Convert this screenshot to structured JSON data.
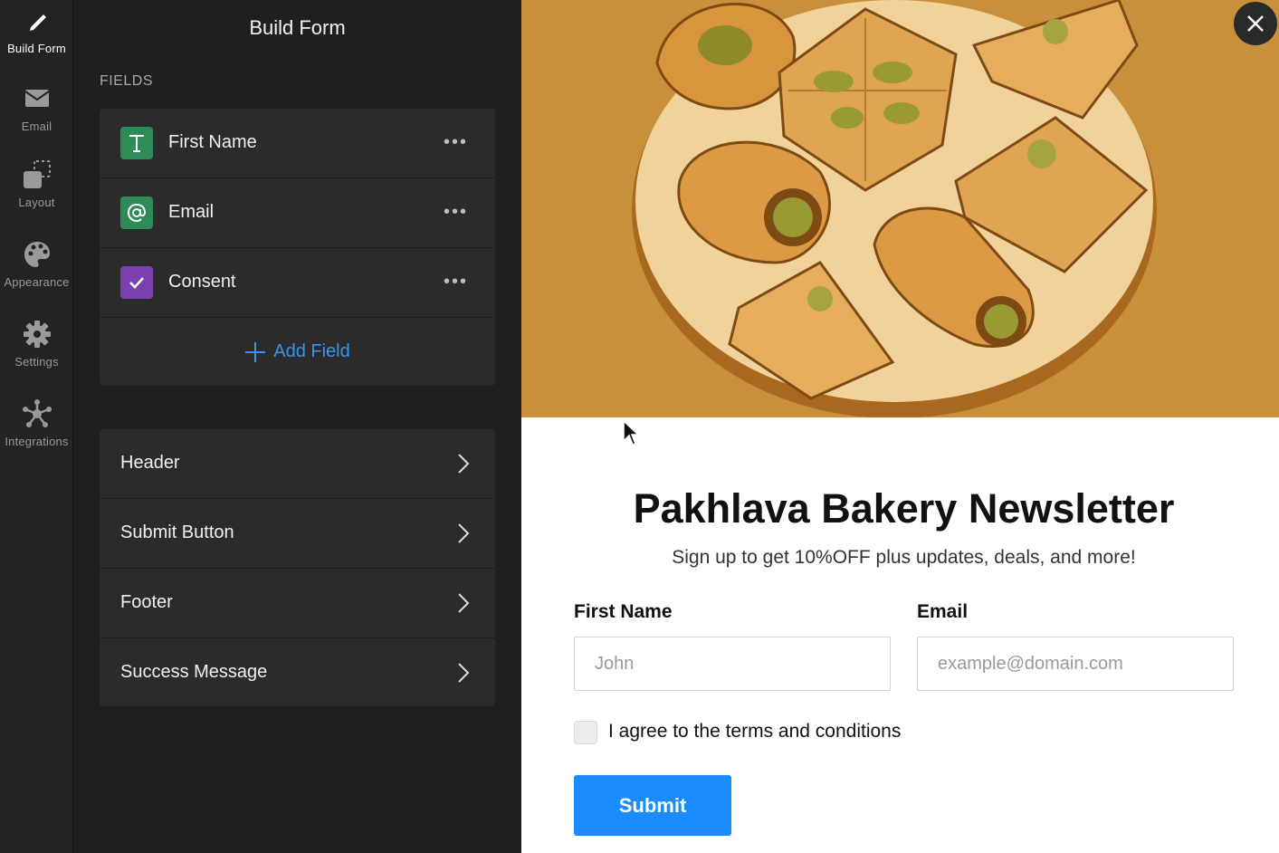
{
  "rail": {
    "items": [
      {
        "label": "Build Form",
        "icon": "pencil-icon",
        "active": true
      },
      {
        "label": "Email",
        "icon": "envelope-icon"
      },
      {
        "label": "Layout",
        "icon": "layout-icon"
      },
      {
        "label": "Appearance",
        "icon": "palette-icon"
      },
      {
        "label": "Settings",
        "icon": "gear-icon"
      },
      {
        "label": "Integrations",
        "icon": "integrations-icon"
      }
    ]
  },
  "panel": {
    "title": "Build Form",
    "fields_label": "FIELDS",
    "fields": [
      {
        "label": "First Name",
        "icon": "text-icon",
        "color": "#2e8b57",
        "more": "•••"
      },
      {
        "label": "Email",
        "icon": "at-icon",
        "color": "#2e8b57",
        "more": "•••"
      },
      {
        "label": "Consent",
        "icon": "checkbox-icon",
        "color": "#7b3fb0",
        "more": "•••"
      }
    ],
    "add_field_label": "Add Field",
    "sections": [
      {
        "label": "Header"
      },
      {
        "label": "Submit Button"
      },
      {
        "label": "Footer"
      },
      {
        "label": "Success Message"
      }
    ]
  },
  "preview": {
    "hero_image": "baklava-plate-illustration",
    "title": "Pakhlava Bakery Newsletter",
    "subtitle": "Sign up to get 10%OFF plus updates, deals, and more!",
    "first_name_label": "First Name",
    "first_name_placeholder": "John",
    "email_label": "Email",
    "email_placeholder": "example@domain.com",
    "consent_text": "I agree to the terms and conditions",
    "submit_label": "Submit"
  },
  "colors": {
    "accent": "#1a8cff",
    "add_field": "#3a94ee",
    "hero_bg": "#c8903a"
  }
}
